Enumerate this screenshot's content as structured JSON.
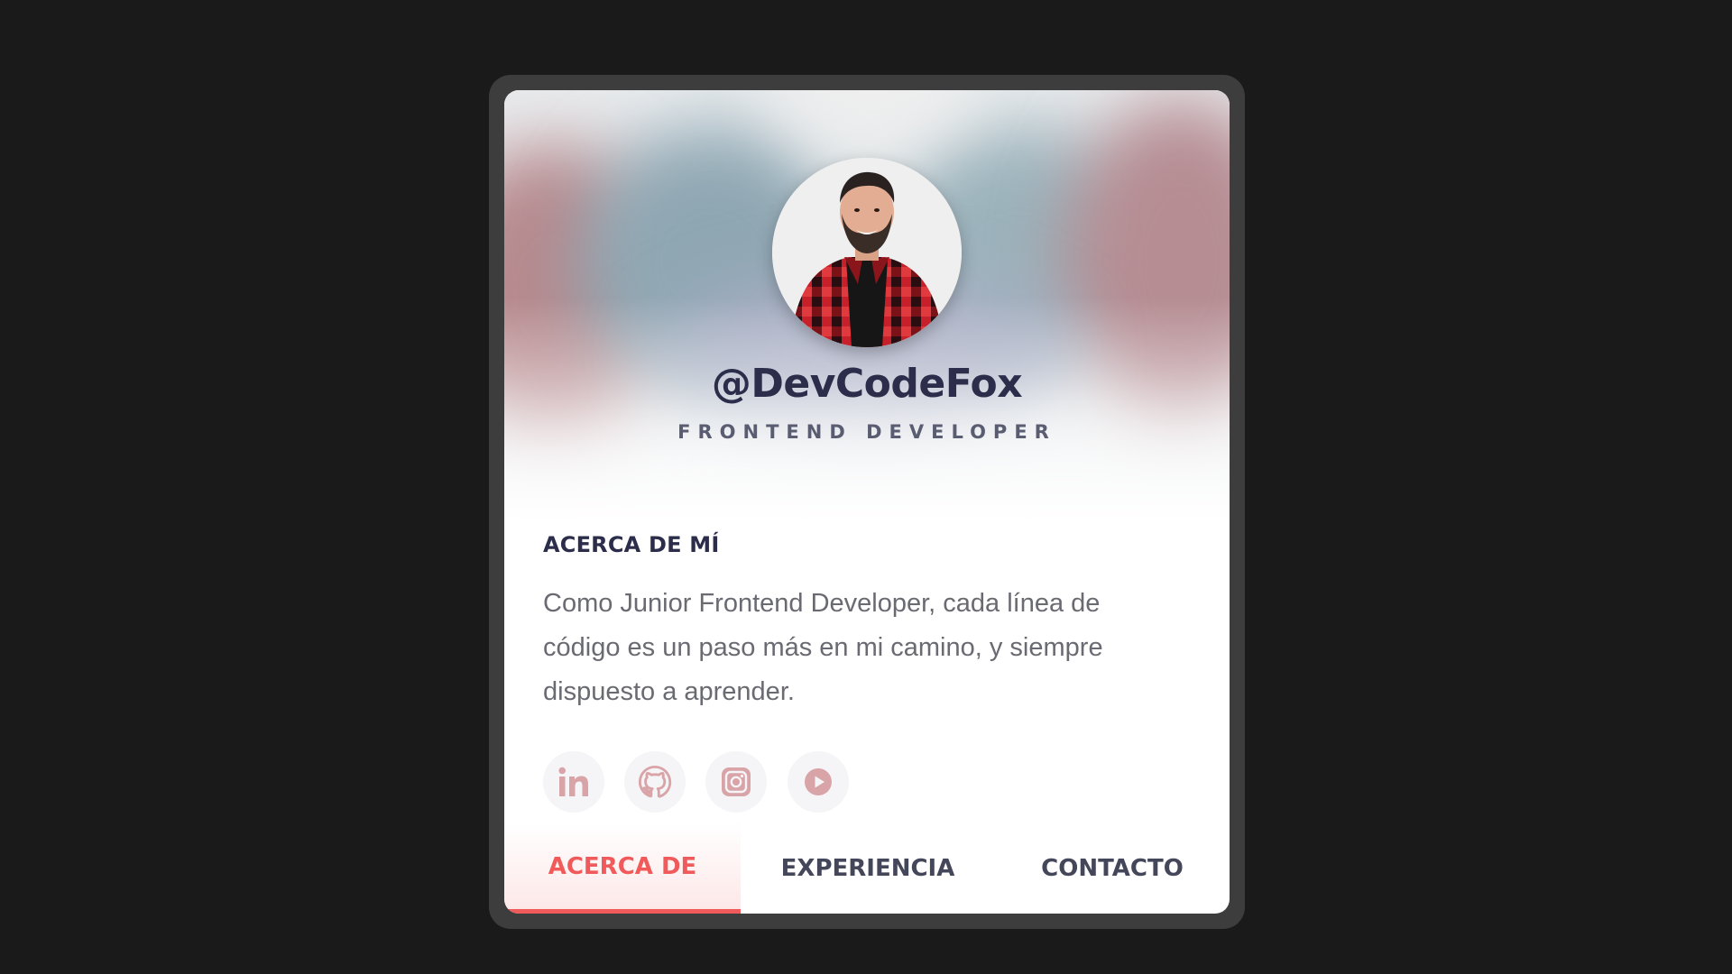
{
  "profile": {
    "handle": "@DevCodeFox",
    "role": "FRONTEND DEVELOPER"
  },
  "about": {
    "title": "ACERCA DE MÍ",
    "text": "Como Junior Frontend Developer, cada línea de código es un paso más en mi camino, y siempre dispuesto a aprender."
  },
  "socials": [
    {
      "icon": "linkedin-icon"
    },
    {
      "icon": "github-icon"
    },
    {
      "icon": "instagram-icon"
    },
    {
      "icon": "youtube-icon"
    }
  ],
  "tabs": [
    {
      "label": "ACERCA DE",
      "active": true
    },
    {
      "label": "EXPERIENCIA",
      "active": false
    },
    {
      "label": "CONTACTO",
      "active": false
    }
  ],
  "colors": {
    "background": "#1a1a1a",
    "frame": "#3d3d3d",
    "accent": "#f05a5a",
    "heading": "#2b2d4a",
    "icon": "#d9a4a8"
  }
}
